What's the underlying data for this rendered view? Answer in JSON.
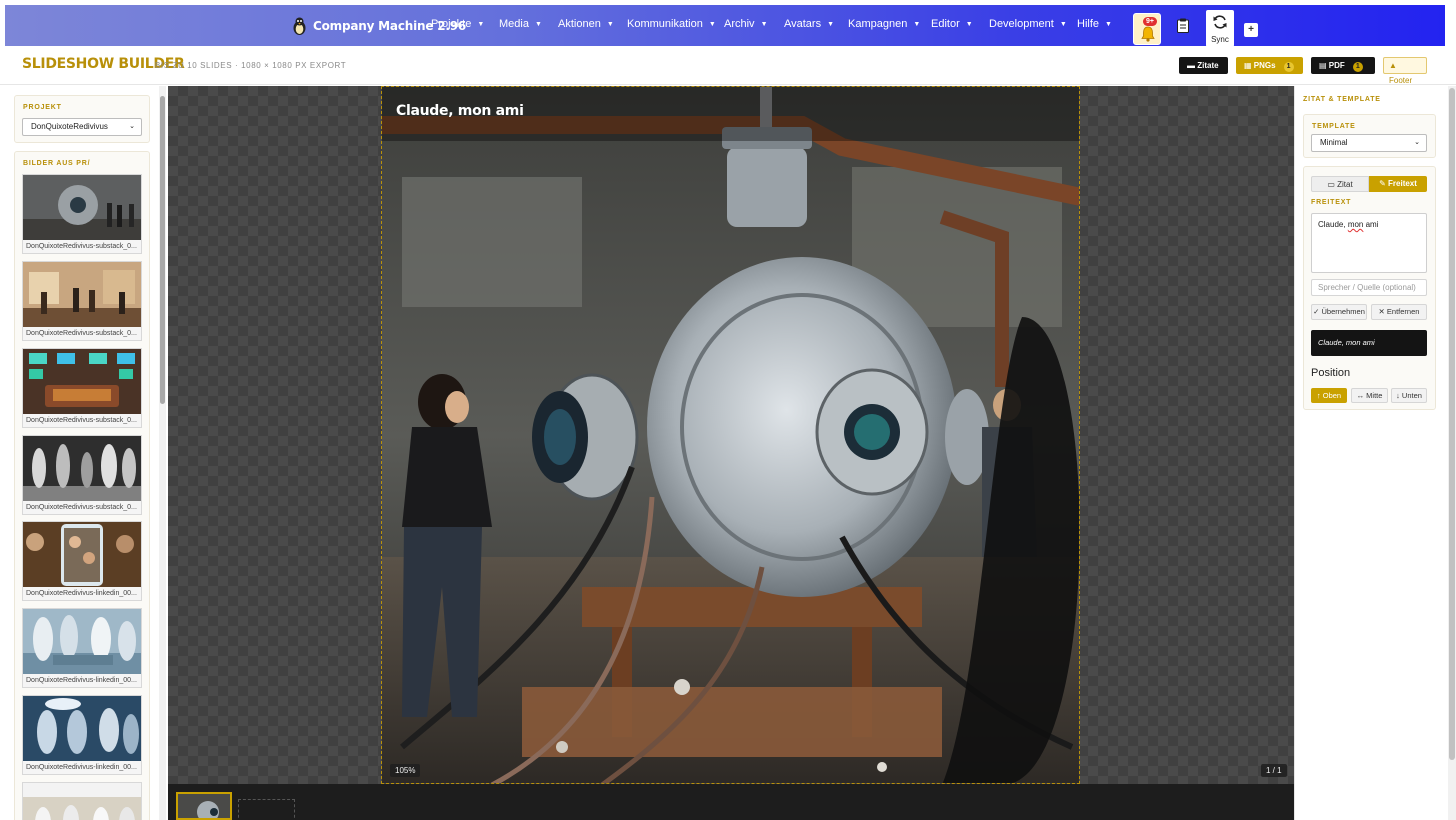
{
  "app": {
    "title": "Company Machine 2.96"
  },
  "nav": {
    "items": [
      {
        "label": "Projekte"
      },
      {
        "label": "Media"
      },
      {
        "label": "Aktionen"
      },
      {
        "label": "Kommunikation"
      },
      {
        "label": "Archiv"
      },
      {
        "label": "Avatars"
      },
      {
        "label": "Kampagnen"
      },
      {
        "label": "Editor"
      },
      {
        "label": "Development"
      },
      {
        "label": "Hilfe"
      }
    ],
    "notifications_badge": "9+",
    "sync_label": "Sync",
    "plus_label": "+"
  },
  "page": {
    "title": "SLIDESHOW BUILDER",
    "subtitle": "BIS ZU 10 SLIDES · 1080 × 1080 PX EXPORT"
  },
  "toolbar": {
    "zitate_label": "Zitate",
    "pngs_label": "PNGs",
    "pngs_count": "1",
    "pdf_label": "PDF",
    "pdf_count": "1",
    "footer_label": "▲ Footer"
  },
  "sidebar": {
    "project_label": "PROJEKT",
    "project_value": "DonQuixoteRedivivus",
    "images_label": "BILDER AUS PR/",
    "images": [
      {
        "caption": "DonQuixoteRedivivus-substack_0..."
      },
      {
        "caption": "DonQuixoteRedivivus-substack_0..."
      },
      {
        "caption": "DonQuixoteRedivivus-substack_0..."
      },
      {
        "caption": "DonQuixoteRedivivus-substack_0..."
      },
      {
        "caption": "DonQuixoteRedivivus-linkedin_00..."
      },
      {
        "caption": "DonQuixoteRedivivus-linkedin_00..."
      },
      {
        "caption": "DonQuixoteRedivivus-linkedin_00..."
      },
      {
        "caption": ""
      }
    ]
  },
  "canvas": {
    "overlay_text": "Claude, mon ami",
    "zoom": "105%",
    "pager": "1 / 1"
  },
  "right": {
    "section_title": "ZITAT & TEMPLATE",
    "template_label": "TEMPLATE",
    "template_value": "Minimal",
    "mode_zitat": "Zitat",
    "mode_freitext": "Freitext",
    "freitext_label": "FREITEXT",
    "freitext_word1": "Claude,",
    "freitext_word2": "mon",
    "freitext_word3": "ami",
    "speaker_placeholder": "Sprecher / Quelle (optional)",
    "apply_label": "Übernehmen",
    "remove_label": "Entfernen",
    "preview_text": "Claude, mon ami",
    "position_label": "Position",
    "pos_top": "Oben",
    "pos_mid": "Mitte",
    "pos_bottom": "Unten"
  },
  "colors": {
    "accent_gold": "#c9a100",
    "title_gold": "#b8900a",
    "nav_gradient_start": "#7d86d8",
    "nav_gradient_end": "#2323f0"
  }
}
